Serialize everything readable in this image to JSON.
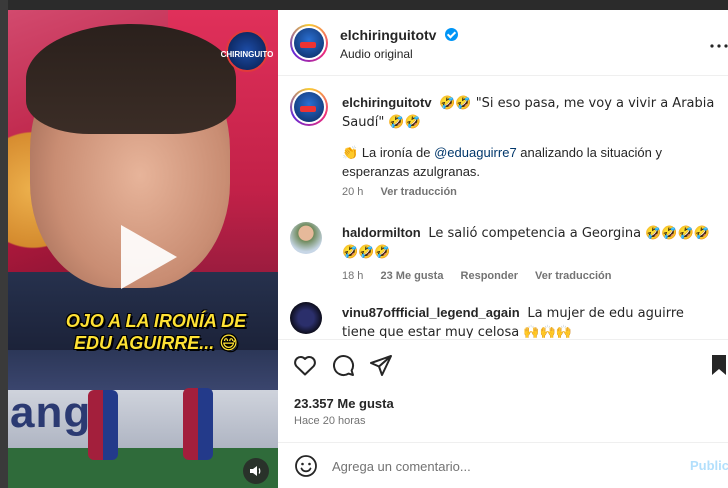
{
  "video": {
    "caption_line1": "OJO A LA IRONÍA DE",
    "caption_line2": "EDU AGUIRRE...",
    "caption_emoji": "😅",
    "banner_text": "anga",
    "logo_text": "CHIRINGUITO"
  },
  "post": {
    "username": "elchiringuitotv",
    "audio": "Audio original",
    "more_icon": "more-dots-icon"
  },
  "comments": [
    {
      "username": "elchiringuitotv",
      "text": "🤣🤣 \"Si eso pasa, me voy a vivir a Arabia Saudí\" 🤣🤣",
      "text2_emoji": "👏",
      "text2_pre": "La ironía de ",
      "text2_mention": "@eduaguirre7",
      "text2_post": " analizando la situación y esperanzas azulgranas.",
      "time": "20 h",
      "translate": "Ver traducción"
    },
    {
      "username": "haldormilton",
      "text": "Le salió competencia a Georgina 🤣🤣🤣🤣🤣🤣🤣",
      "time": "18 h",
      "likes": "23 Me gusta",
      "reply": "Responder",
      "translate": "Ver traducción"
    },
    {
      "username": "vinu87offficial_legend_again",
      "text": "La mujer de edu aguirre tiene que estar muy celosa 🙌🙌🙌"
    }
  ],
  "actions": {
    "likes": "23.357 Me gusta",
    "time": "Hace 20 horas"
  },
  "composer": {
    "placeholder": "Agrega un comentario...",
    "publish": "Publicar"
  },
  "colors": {
    "accent": "#0095f6",
    "mention": "#00376b",
    "caption": "#ffe234"
  }
}
